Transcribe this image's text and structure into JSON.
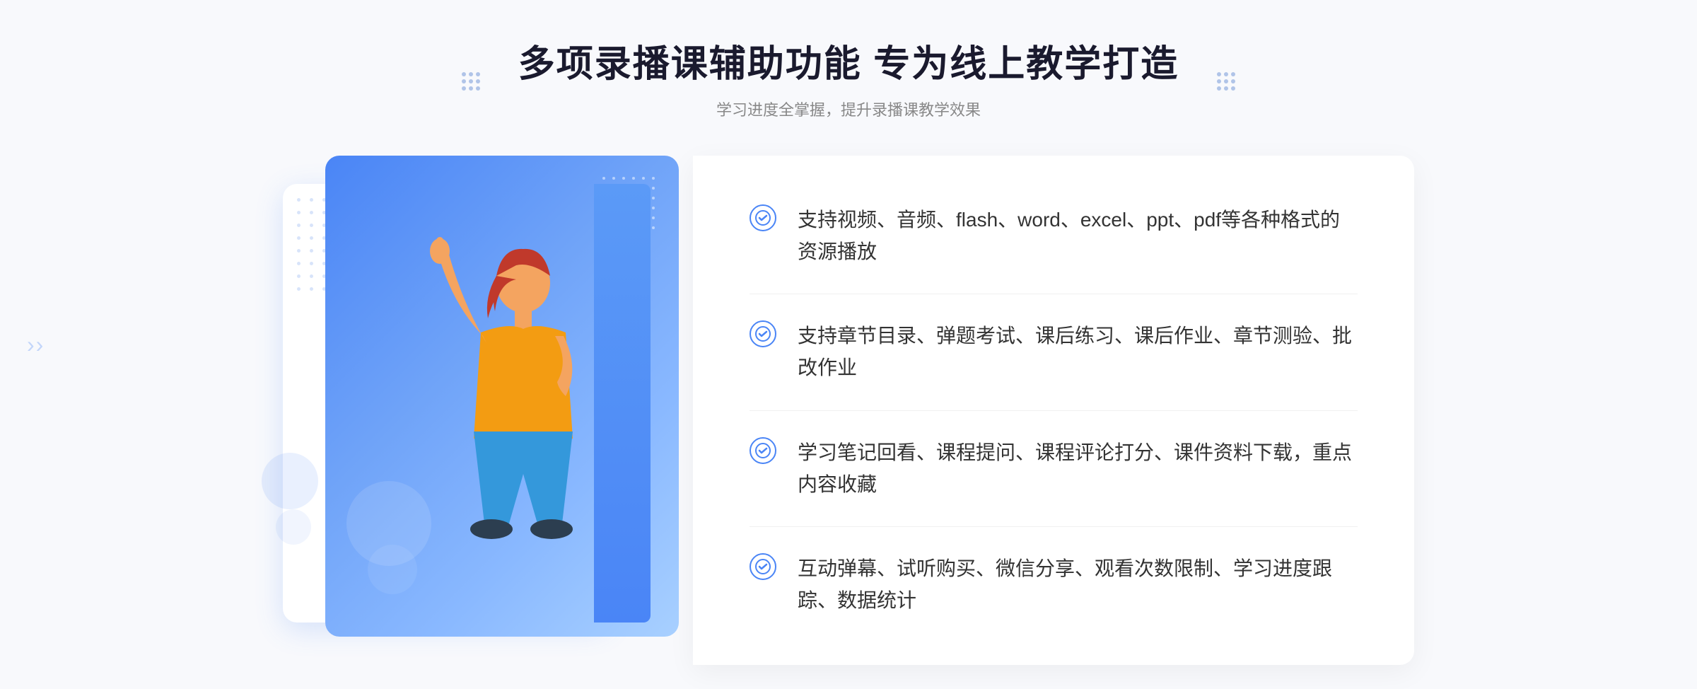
{
  "header": {
    "title": "多项录播课辅助功能 专为线上教学打造",
    "subtitle": "学习进度全掌握，提升录播课教学效果"
  },
  "features": [
    {
      "id": "feature-1",
      "text": "支持视频、音频、flash、word、excel、ppt、pdf等各种格式的资源播放"
    },
    {
      "id": "feature-2",
      "text": "支持章节目录、弹题考试、课后练习、课后作业、章节测验、批改作业"
    },
    {
      "id": "feature-3",
      "text": "学习笔记回看、课程提问、课程评论打分、课件资料下载，重点内容收藏"
    },
    {
      "id": "feature-4",
      "text": "互动弹幕、试听购买、微信分享、观看次数限制、学习进度跟踪、数据统计"
    }
  ],
  "decorations": {
    "check_symbol": "✓",
    "play_arrow": "▶",
    "left_arrows": "«",
    "sparkle_star": "✦"
  }
}
